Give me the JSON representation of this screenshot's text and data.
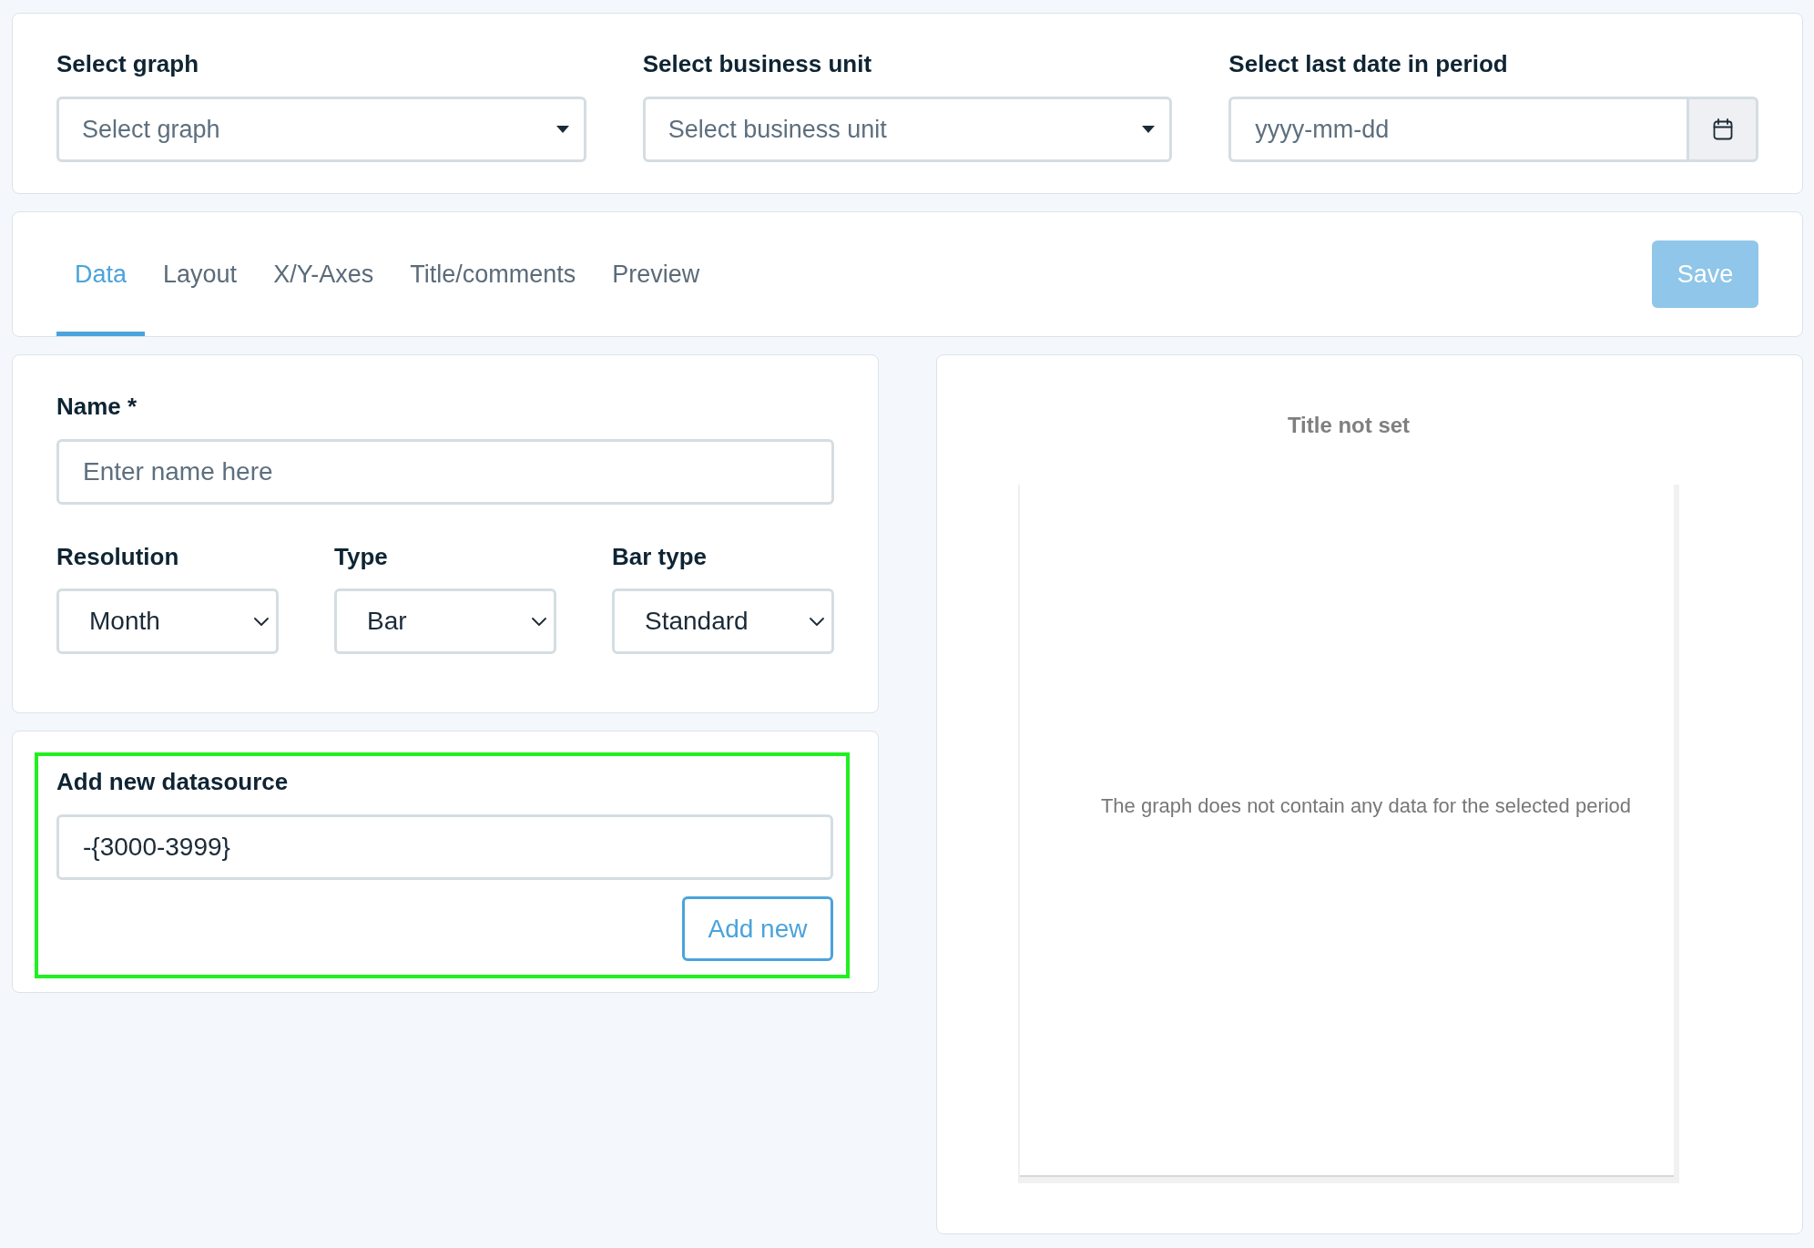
{
  "filters": [
    {
      "label": "Select graph",
      "kind": "dropdown",
      "placeholder": "Select graph"
    },
    {
      "label": "Select business unit",
      "kind": "dropdown",
      "placeholder": "Select business unit"
    },
    {
      "label": "Select last date in period",
      "kind": "date",
      "placeholder": "yyyy-mm-dd"
    }
  ],
  "tabs": [
    {
      "label": "Data",
      "selected": true
    },
    {
      "label": "Layout",
      "selected": false
    },
    {
      "label": "X/Y-Axes",
      "selected": false
    },
    {
      "label": "Title/comments",
      "selected": false
    },
    {
      "label": "Preview",
      "selected": false
    }
  ],
  "save_button": {
    "label": "Save",
    "disabled": true
  },
  "name_field": {
    "label": "Name *",
    "placeholder": "Enter name here"
  },
  "settings": [
    {
      "label": "Resolution",
      "value": "Month"
    },
    {
      "label": "Type",
      "value": "Bar"
    },
    {
      "label": "Bar type",
      "value": "Standard"
    }
  ],
  "datasource": {
    "title": "Add new datasource",
    "value": "-{3000-3999}",
    "button": "Add new",
    "highlighted": true
  },
  "preview": {
    "title": "Title not set",
    "message": "The graph does not contain any data for the selected period"
  }
}
